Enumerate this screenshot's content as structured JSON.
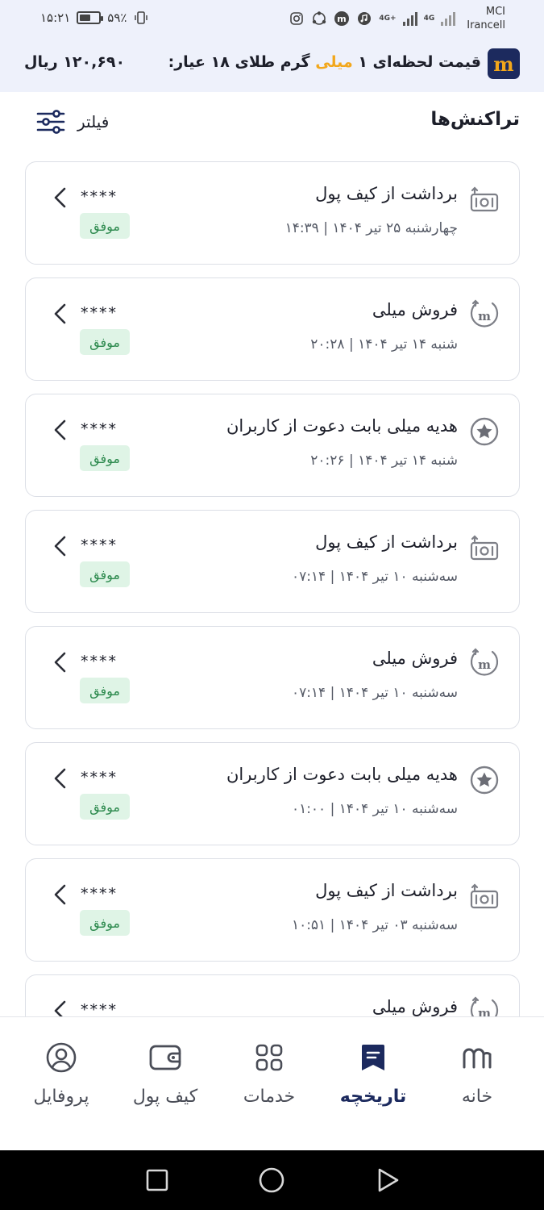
{
  "status_bar": {
    "time": "۱۵:۲۱",
    "battery": "۵۹٪",
    "battery_level": 0.59,
    "carrier_1": "MCI",
    "carrier_2": "Irancell",
    "network_1": "4G+",
    "network_2": "4G",
    "icons": [
      "instagram-icon",
      "app-icon",
      "mili-app-icon",
      "music-icon",
      "vibrate-icon"
    ]
  },
  "price_banner": {
    "text_before": "قیمت لحظه‌ای ۱ ",
    "text_accent": "میلی",
    "text_after": " گرم طلای ۱۸ عیار:",
    "value": "۱۲۰,۶۹۰ ریال",
    "accent_color": "#f2a71b",
    "logo_letter": "m"
  },
  "header": {
    "title": "تراکنش‌ها",
    "filter_label": "فیلتر"
  },
  "transactions": [
    {
      "title": "برداشت از کیف پول",
      "date": "چهارشنبه ۲۵ تیر ۱۴۰۴ | ۱۴:۳۹",
      "amount": "****",
      "status": "موفق",
      "icon": "cash-withdraw-icon"
    },
    {
      "title": "فروش میلی",
      "date": "شنبه ۱۴ تیر ۱۴۰۴ | ۲۰:۲۸",
      "amount": "****",
      "status": "موفق",
      "icon": "mili-sell-icon"
    },
    {
      "title": "هدیه میلی بابت دعوت از کاربران",
      "date": "شنبه ۱۴ تیر ۱۴۰۴ | ۲۰:۲۶",
      "amount": "****",
      "status": "موفق",
      "icon": "star-gift-icon"
    },
    {
      "title": "برداشت از کیف پول",
      "date": "سه‌شنبه ۱۰ تیر ۱۴۰۴ | ۰۷:۱۴",
      "amount": "****",
      "status": "موفق",
      "icon": "cash-withdraw-icon"
    },
    {
      "title": "فروش میلی",
      "date": "سه‌شنبه ۱۰ تیر ۱۴۰۴ | ۰۷:۱۴",
      "amount": "****",
      "status": "موفق",
      "icon": "mili-sell-icon"
    },
    {
      "title": "هدیه میلی بابت دعوت از کاربران",
      "date": "سه‌شنبه ۱۰ تیر ۱۴۰۴ | ۰۱:۰۰",
      "amount": "****",
      "status": "موفق",
      "icon": "star-gift-icon"
    },
    {
      "title": "برداشت از کیف پول",
      "date": "سه‌شنبه ۰۳ تیر ۱۴۰۴ | ۱۰:۵۱",
      "amount": "****",
      "status": "موفق",
      "icon": "cash-withdraw-icon"
    },
    {
      "title": "فروش میلی",
      "date": "",
      "amount": "****",
      "status": "",
      "icon": "mili-sell-icon"
    }
  ],
  "bottom_nav": {
    "items": [
      {
        "label": "خانه",
        "icon": "home-logo-icon",
        "active": false
      },
      {
        "label": "تاریخچه",
        "icon": "history-icon",
        "active": true
      },
      {
        "label": "خدمات",
        "icon": "services-grid-icon",
        "active": false
      },
      {
        "label": "کیف پول",
        "icon": "wallet-icon",
        "active": false
      },
      {
        "label": "پروفایل",
        "icon": "profile-icon",
        "active": false
      }
    ]
  },
  "colors": {
    "primary_navy": "#1c2a5e",
    "success_bg": "#dff4e6",
    "success_text": "#2d8a4e",
    "banner_bg": "#eef1fb"
  }
}
